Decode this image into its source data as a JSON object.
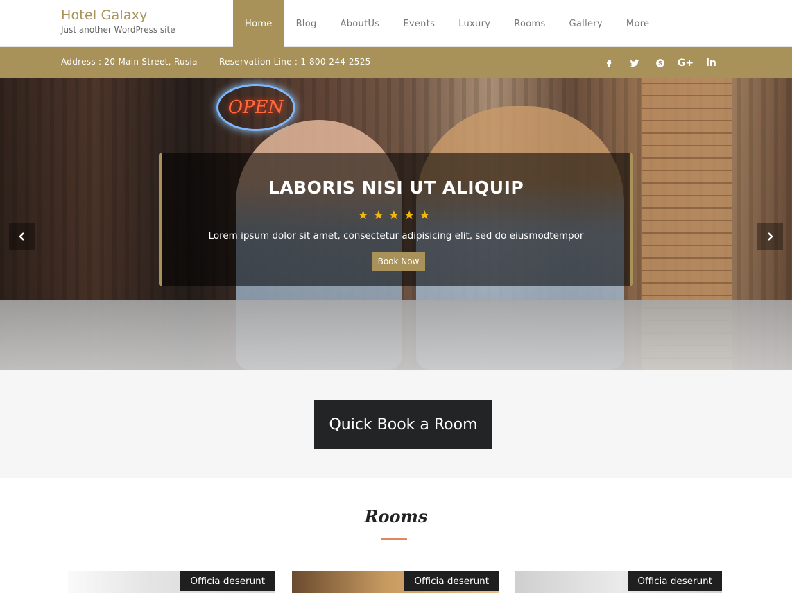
{
  "site": {
    "title": "Hotel Galaxy",
    "tagline": "Just another WordPress site"
  },
  "nav": {
    "items": [
      "Home",
      "Blog",
      "AboutUs",
      "Events",
      "Luxury",
      "Rooms",
      "Gallery",
      "More"
    ],
    "active": "Home"
  },
  "infobar": {
    "address": "Address :  20 Main Street, Rusia",
    "reservation": "Reservation Line :  1-800-244-2525",
    "social_icons": [
      "facebook-icon",
      "twitter-icon",
      "skype-icon",
      "google-plus-icon",
      "linkedin-icon"
    ]
  },
  "hero": {
    "sign_text": "OPEN",
    "title": "LABORIS NISI UT ALIQUIP",
    "stars": "★★★★★",
    "rating": 5,
    "text": "Lorem ipsum dolor sit amet, consectetur adipisicing elit, sed do eiusmodtempor",
    "button": "Book Now"
  },
  "quick_book": {
    "button": "Quick Book a Room"
  },
  "rooms": {
    "title": "Rooms",
    "cards": [
      {
        "label": "Officia deserunt"
      },
      {
        "label": "Officia deserunt"
      },
      {
        "label": "Officia deserunt"
      }
    ]
  },
  "colors": {
    "accent": "#a89259",
    "dark": "#222426",
    "underline": "#e0875e",
    "star": "#f2b80f"
  }
}
